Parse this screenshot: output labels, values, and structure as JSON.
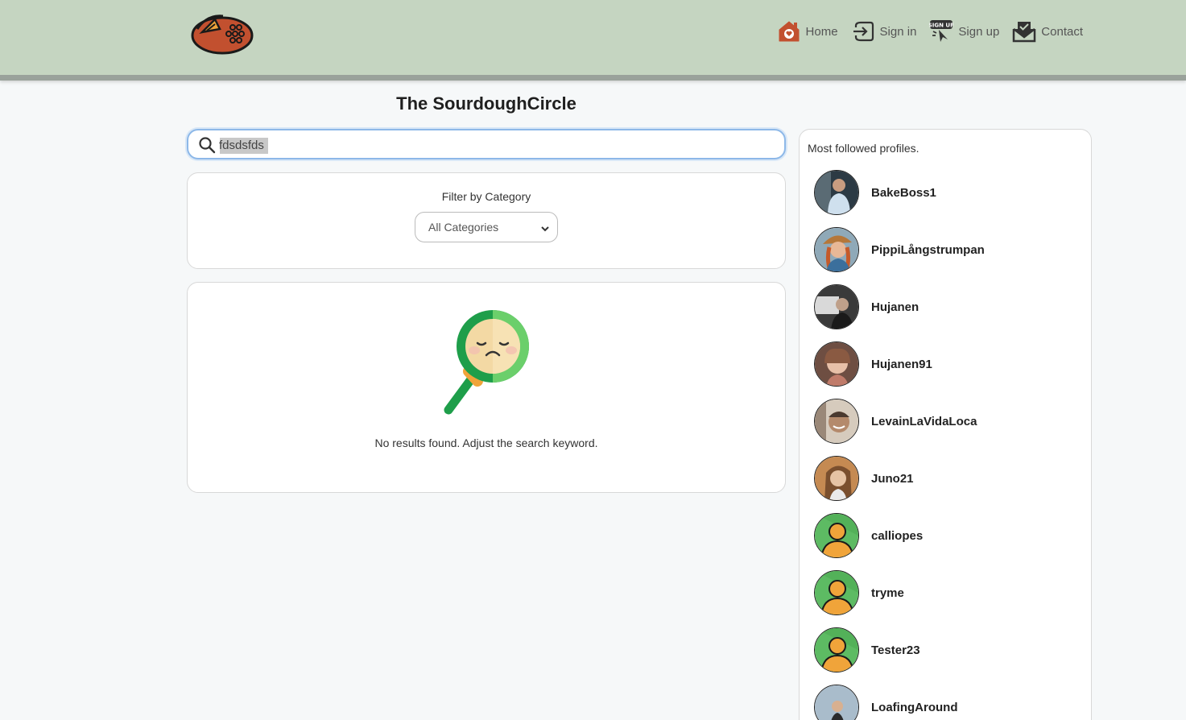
{
  "nav": {
    "links": [
      {
        "label": "Home",
        "icon": "home-heart-icon"
      },
      {
        "label": "Sign in",
        "icon": "sign-in-icon"
      },
      {
        "label": "Sign up",
        "icon": "sign-up-icon"
      },
      {
        "label": "Contact",
        "icon": "mail-icon"
      }
    ]
  },
  "page": {
    "title": "The SourdoughCircle"
  },
  "search": {
    "value": "fdsdsfds",
    "icon": "search-icon"
  },
  "filter": {
    "label": "Filter by Category",
    "selected": "All Categories"
  },
  "results": {
    "empty_message": "No results found. Adjust the search keyword.",
    "icon": "sad-magnifier-icon"
  },
  "sidebar": {
    "title": "Most followed profiles.",
    "profiles": [
      {
        "name": "BakeBoss1",
        "avatar": "photo"
      },
      {
        "name": "PippiLångstrumpan",
        "avatar": "photo"
      },
      {
        "name": "Hujanen",
        "avatar": "photo"
      },
      {
        "name": "Hujanen91",
        "avatar": "photo"
      },
      {
        "name": "LevainLaVidaLoca",
        "avatar": "photo"
      },
      {
        "name": "Juno21",
        "avatar": "photo"
      },
      {
        "name": "calliopes",
        "avatar": "default"
      },
      {
        "name": "tryme",
        "avatar": "default"
      },
      {
        "name": "Tester23",
        "avatar": "default"
      },
      {
        "name": "LoafingAround",
        "avatar": "photo"
      }
    ]
  },
  "colors": {
    "navbar": "#c5d5c1",
    "brand_orange": "#c2502f",
    "avatar_green": "#5dbb63",
    "avatar_orange": "#f0a43a"
  }
}
